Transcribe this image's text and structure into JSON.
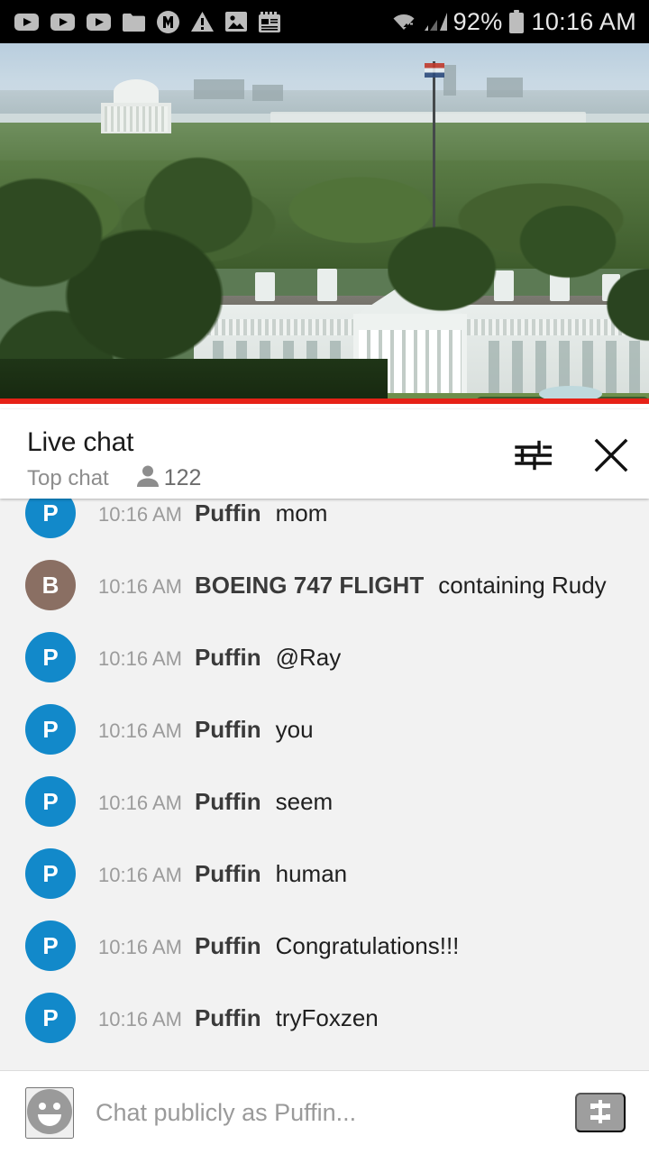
{
  "status_bar": {
    "notification_icons": [
      "youtube-play-icon",
      "youtube-play-icon",
      "youtube-play-icon",
      "folder-icon",
      "m-circle-icon",
      "warning-triangle-icon",
      "image-icon",
      "news-note-icon"
    ],
    "system_icons": [
      "wifi-icon",
      "cellular-signal-icon",
      "battery-icon"
    ],
    "battery_percent": "92%",
    "clock": "10:16 AM"
  },
  "video": {
    "scene_description": "Aerial live view of the White House in Washington D.C.",
    "progress_color": "#e62117",
    "progress_percent": 100
  },
  "chat": {
    "title": "Live chat",
    "mode": "Top chat",
    "viewer_count": "122",
    "viewer_icon": "person-icon",
    "filter_icon": "tune-filter-icon",
    "close_icon": "close-icon",
    "avatar_colors": {
      "puffin": "#1289ca",
      "boeing": "#8a6f63"
    },
    "messages": [
      {
        "avatar_letter": "P",
        "avatar_color": "#1289ca",
        "time": "10:16 AM",
        "author": "Puffin",
        "text": "mom"
      },
      {
        "avatar_letter": "B",
        "avatar_color": "#8a6f63",
        "time": "10:16 AM",
        "author": "BOEING 747 FLIGHT",
        "text": "containing Rudy"
      },
      {
        "avatar_letter": "P",
        "avatar_color": "#1289ca",
        "time": "10:16 AM",
        "author": "Puffin",
        "text": "@Ray"
      },
      {
        "avatar_letter": "P",
        "avatar_color": "#1289ca",
        "time": "10:16 AM",
        "author": "Puffin",
        "text": "you"
      },
      {
        "avatar_letter": "P",
        "avatar_color": "#1289ca",
        "time": "10:16 AM",
        "author": "Puffin",
        "text": "seem"
      },
      {
        "avatar_letter": "P",
        "avatar_color": "#1289ca",
        "time": "10:16 AM",
        "author": "Puffin",
        "text": "human"
      },
      {
        "avatar_letter": "P",
        "avatar_color": "#1289ca",
        "time": "10:16 AM",
        "author": "Puffin",
        "text": "Congratulations!!!"
      },
      {
        "avatar_letter": "P",
        "avatar_color": "#1289ca",
        "time": "10:16 AM",
        "author": "Puffin",
        "text": "tryFoxzen"
      }
    ]
  },
  "input_bar": {
    "emoji_icon": "emoji-smiley-icon",
    "placeholder": "Chat publicly as Puffin...",
    "value": "",
    "superchat_icon": "dollar-banknote-icon"
  }
}
